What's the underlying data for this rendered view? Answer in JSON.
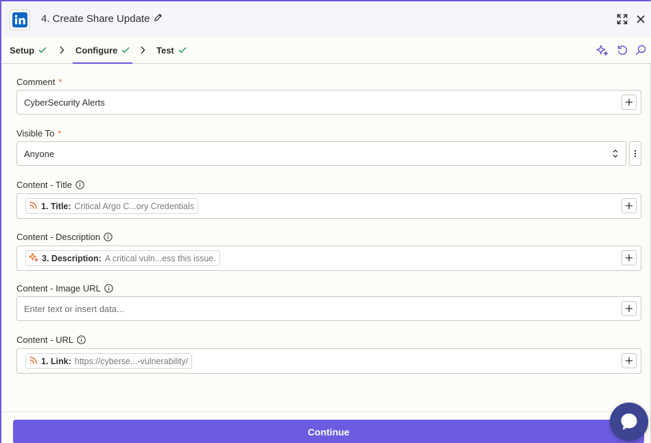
{
  "header": {
    "title": "4. Create Share Update",
    "app_icon": "linkedin-icon"
  },
  "tabs": [
    {
      "label": "Setup",
      "done": true
    },
    {
      "label": "Configure",
      "done": true,
      "active": true
    },
    {
      "label": "Test",
      "done": true
    }
  ],
  "fields": {
    "comment": {
      "label": "Comment",
      "required": "*",
      "value": "CyberSecurity Alerts"
    },
    "visible_to": {
      "label": "Visible To",
      "required": "*",
      "value": "Anyone"
    },
    "content_title": {
      "label": "Content - Title",
      "pill_key": "1. Title:",
      "pill_value": "Critical Argo C...ory Credentials"
    },
    "content_description": {
      "label": "Content - Description",
      "pill_key": "3. Description:",
      "pill_value": "A critical vuln...ess this issue."
    },
    "content_image_url": {
      "label": "Content - Image URL",
      "placeholder": "Enter text or insert data..."
    },
    "content_url": {
      "label": "Content - URL",
      "pill_key": "1. Link:",
      "pill_value": "https://cyberse...-vulnerability/"
    }
  },
  "footer": {
    "continue_label": "Continue"
  },
  "colors": {
    "accent": "#6959d9",
    "button": "#6b5ce0",
    "check": "#1f9d55",
    "required": "#e86b2f",
    "rss": "#e86b2f",
    "chat": "#3d4592"
  }
}
